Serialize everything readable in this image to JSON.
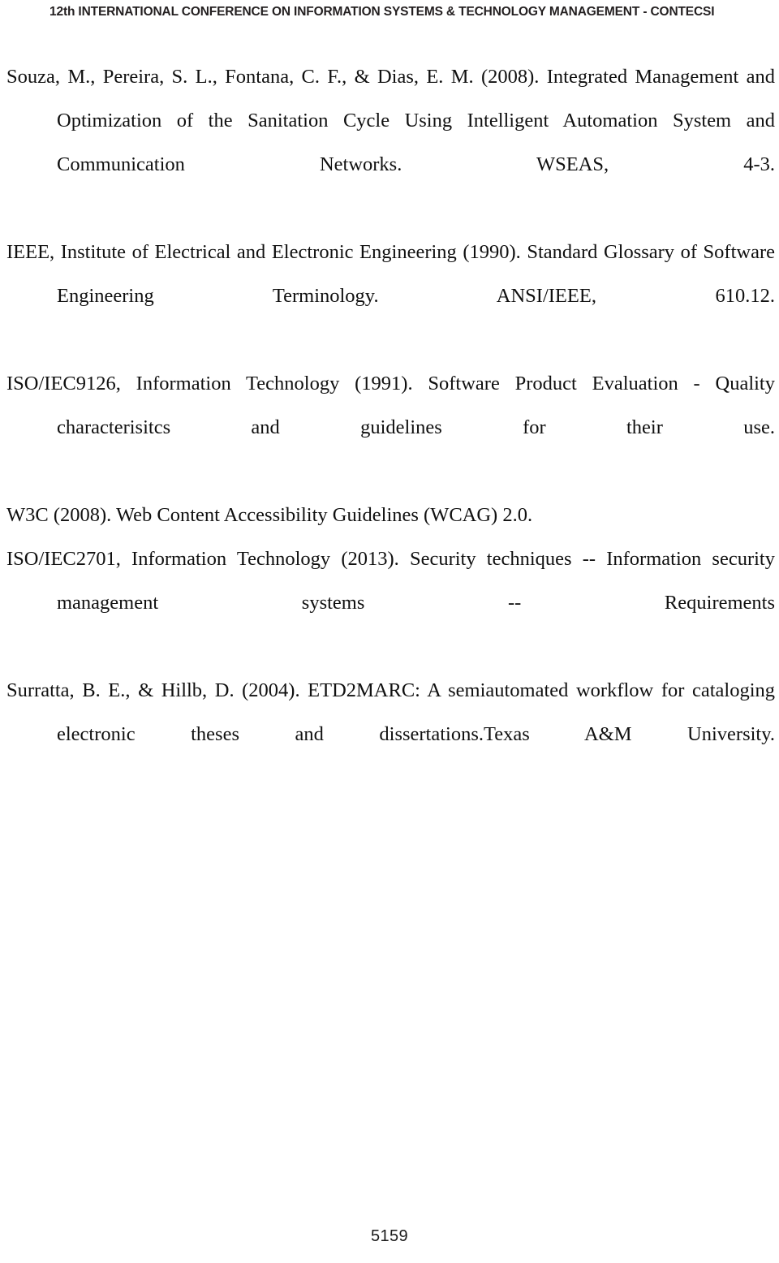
{
  "document": {
    "type": "conference-proceedings-references-page",
    "header": {
      "text": "12th INTERNATIONAL CONFERENCE ON INFORMATION SYSTEMS & TECHNOLOGY MANAGEMENT - CONTECSI"
    },
    "footer": {
      "page_number": "5159"
    },
    "references": [
      {
        "id": "souza-2008",
        "text": "Souza, M., Pereira, S. L., Fontana, C. F., & Dias, E. M. (2008). Integrated Management and Optimization of the Sanitation Cycle Using Intelligent Automation System and Communication Networks. WSEAS, 4-3.",
        "lines": 3
      },
      {
        "id": "ieee-1990",
        "text": "IEEE, Institute of Electrical and Electronic Engineering (1990). Standard Glossary of Software Engineering Terminology. ANSI/IEEE, 610.12.",
        "lines": 2
      },
      {
        "id": "iso-iec-9126-1991",
        "text": "ISO/IEC9126, Information Technology (1991). Software Product Evaluation - Quality characterisitcs and guidelines for their use.",
        "lines": 2
      },
      {
        "id": "w3c-2008",
        "text": "W3C (2008). Web Content Accessibility Guidelines (WCAG) 2.0.",
        "lines": 1
      },
      {
        "id": "iso-iec-2701-2013",
        "text": "ISO/IEC2701, Information Technology (2013). Security techniques -- Information security management systems -- Requirements",
        "lines": 2
      },
      {
        "id": "surratta-2004",
        "text": "Surratta, B. E., & Hillb, D. (2004). ETD2MARC: A semiautomated workflow for cataloging electronic theses and dissertations.Texas A&M University.",
        "lines": 2
      }
    ]
  },
  "colors": {
    "page_background": "#ffffff",
    "body_text": "#101010",
    "header_text": "#231f20",
    "footer_text": "#1a1a1a"
  }
}
